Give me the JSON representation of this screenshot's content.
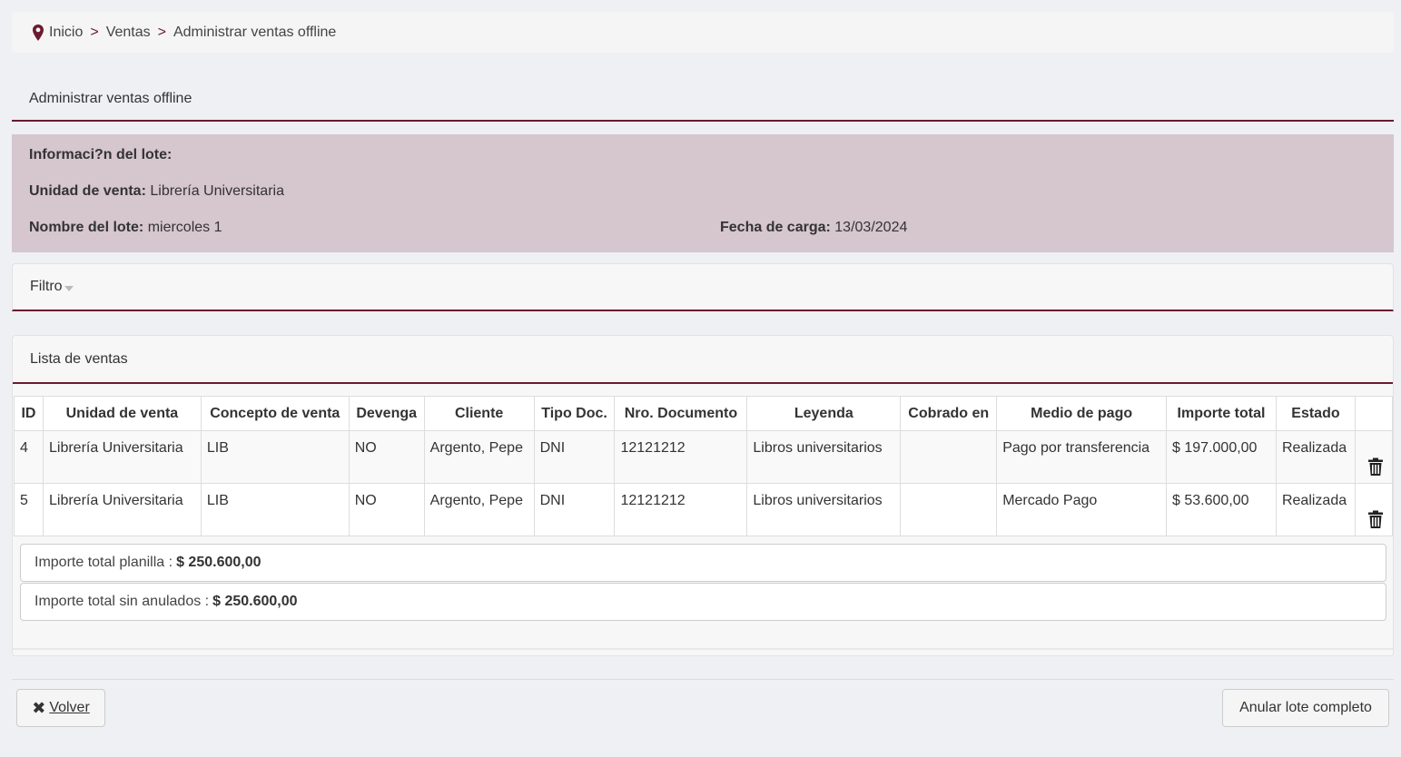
{
  "breadcrumb": {
    "items": [
      "Inicio",
      "Ventas",
      "Administrar ventas offline"
    ],
    "separator": ">"
  },
  "page_title": "Administrar ventas offline",
  "lote_info": {
    "heading": "Informaci?n del lote:",
    "unidad_label": "Unidad de venta:",
    "unidad_value": "Librería Universitaria",
    "nombre_label": "Nombre del lote:",
    "nombre_value": "miercoles 1",
    "fecha_label": "Fecha de carga:",
    "fecha_value": "13/03/2024"
  },
  "filtro": {
    "label": "Filtro"
  },
  "lista": {
    "title": "Lista de ventas",
    "columns": [
      "ID",
      "Unidad de venta",
      "Concepto de venta",
      "Devenga",
      "Cliente",
      "Tipo Doc.",
      "Nro. Documento",
      "Leyenda",
      "Cobrado en",
      "Medio de pago",
      "Importe total",
      "Estado"
    ],
    "rows": [
      [
        "4",
        "Librería Universitaria",
        "LIB",
        "NO",
        "Argento, Pepe",
        "DNI",
        "12121212",
        "Libros universitarios",
        "",
        "Pago por transferencia",
        "$ 197.000,00",
        "Realizada"
      ],
      [
        "5",
        "Librería Universitaria",
        "LIB",
        "NO",
        "Argento, Pepe",
        "DNI",
        "12121212",
        "Libros universitarios",
        "",
        "Mercado Pago",
        "$ 53.600,00",
        "Realizada"
      ]
    ],
    "total_planilla_label": "Importe total planilla :",
    "total_planilla_value": "$ 250.600,00",
    "total_sin_anulados_label": "Importe total sin anulados :",
    "total_sin_anulados_value": "$ 250.600,00"
  },
  "buttons": {
    "volver": "Volver",
    "anular": "Anular lote completo"
  },
  "icons": {
    "breadcrumb": "map-pin-icon",
    "delete": "trash-icon",
    "volver": "close-icon"
  },
  "colors": {
    "accent": "#6b1a2f",
    "info_bg": "#d6c6ce"
  }
}
